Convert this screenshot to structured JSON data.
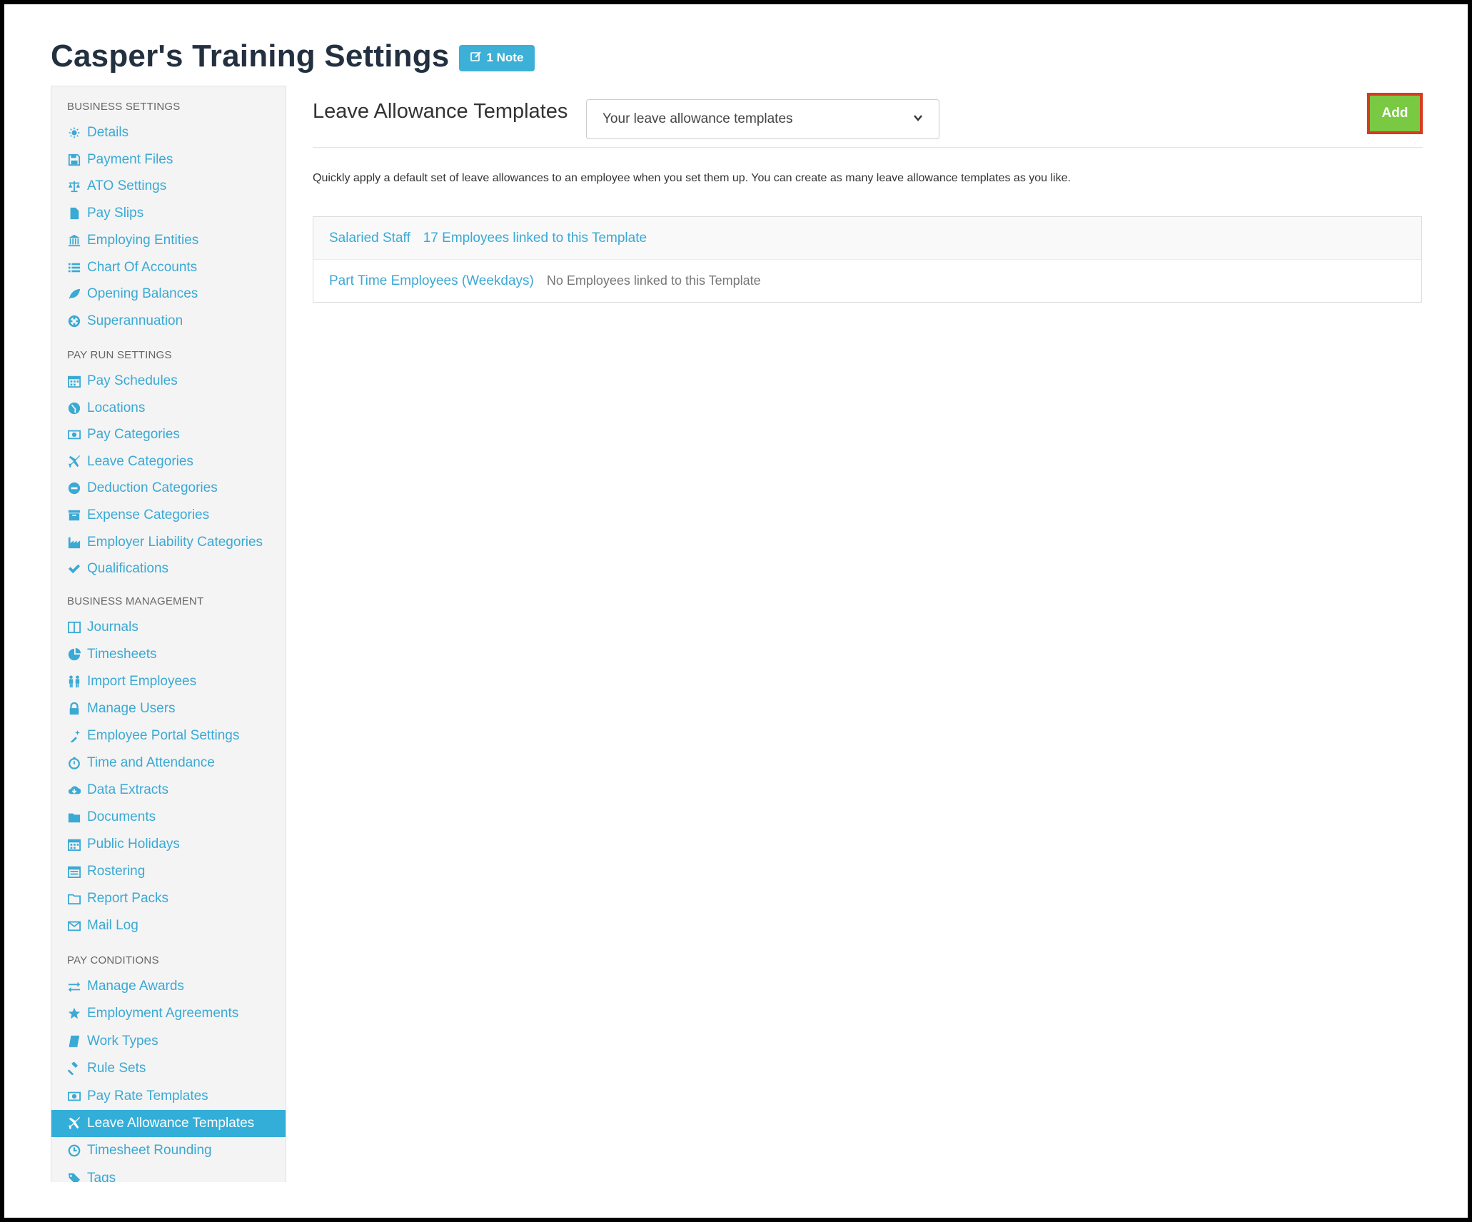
{
  "page": {
    "title": "Casper's Training Settings",
    "note_badge": "1 Note"
  },
  "sidebar": {
    "sections": [
      {
        "header": "Business Settings",
        "items": [
          {
            "label": "Details",
            "icon": "gear-icon"
          },
          {
            "label": "Payment Files",
            "icon": "floppy-disk-icon"
          },
          {
            "label": "ATO Settings",
            "icon": "scales-icon"
          },
          {
            "label": "Pay Slips",
            "icon": "file-icon"
          },
          {
            "label": "Employing Entities",
            "icon": "bank-icon"
          },
          {
            "label": "Chart Of Accounts",
            "icon": "list-icon"
          },
          {
            "label": "Opening Balances",
            "icon": "leaf-icon"
          },
          {
            "label": "Superannuation",
            "icon": "life-ring-icon"
          }
        ]
      },
      {
        "header": "Pay Run Settings",
        "items": [
          {
            "label": "Pay Schedules",
            "icon": "calendar-icon"
          },
          {
            "label": "Locations",
            "icon": "globe-icon"
          },
          {
            "label": "Pay Categories",
            "icon": "money-icon"
          },
          {
            "label": "Leave Categories",
            "icon": "plane-icon"
          },
          {
            "label": "Deduction Categories",
            "icon": "minus-circle-icon"
          },
          {
            "label": "Expense Categories",
            "icon": "archive-icon"
          },
          {
            "label": "Employer Liability Categories",
            "icon": "industry-icon"
          },
          {
            "label": "Qualifications",
            "icon": "check-icon"
          }
        ]
      },
      {
        "header": "Business Management",
        "items": [
          {
            "label": "Journals",
            "icon": "columns-icon"
          },
          {
            "label": "Timesheets",
            "icon": "pie-chart-icon"
          },
          {
            "label": "Import Employees",
            "icon": "people-icon"
          },
          {
            "label": "Manage Users",
            "icon": "lock-icon"
          },
          {
            "label": "Employee Portal Settings",
            "icon": "magic-wand-icon"
          },
          {
            "label": "Time and Attendance",
            "icon": "stopwatch-icon"
          },
          {
            "label": "Data Extracts",
            "icon": "cloud-download-icon"
          },
          {
            "label": "Documents",
            "icon": "folder-icon"
          },
          {
            "label": "Public Holidays",
            "icon": "calendar-icon"
          },
          {
            "label": "Rostering",
            "icon": "calendar-grid-icon"
          },
          {
            "label": "Report Packs",
            "icon": "folder-open-icon"
          },
          {
            "label": "Mail Log",
            "icon": "envelope-icon"
          }
        ]
      },
      {
        "header": "Pay Conditions",
        "items": [
          {
            "label": "Manage Awards",
            "icon": "exchange-icon"
          },
          {
            "label": "Employment Agreements",
            "icon": "star-icon"
          },
          {
            "label": "Work Types",
            "icon": "book-icon"
          },
          {
            "label": "Rule Sets",
            "icon": "gavel-icon"
          },
          {
            "label": "Pay Rate Templates",
            "icon": "money-icon"
          },
          {
            "label": "Leave Allowance Templates",
            "icon": "plane-icon",
            "active": true
          },
          {
            "label": "Timesheet Rounding",
            "icon": "clock-icon"
          },
          {
            "label": "Tags",
            "icon": "tag-icon"
          }
        ]
      }
    ]
  },
  "main": {
    "heading": "Leave Allowance Templates",
    "select_value": "Your leave allowance templates",
    "add_label": "Add",
    "description": "Quickly apply a default set of leave allowances to an employee when you set them up. You can create as many leave allowance templates as you like.",
    "templates": [
      {
        "name": "Salaried Staff",
        "linked": "17 Employees linked to this Template"
      },
      {
        "name": "Part Time Employees (Weekdays)",
        "linked": "No Employees linked to this Template"
      }
    ]
  },
  "colors": {
    "accent": "#3aa9d4",
    "active_nav": "#33aed8",
    "add_button": "#7ac943",
    "add_button_border": "#d63b1f"
  }
}
